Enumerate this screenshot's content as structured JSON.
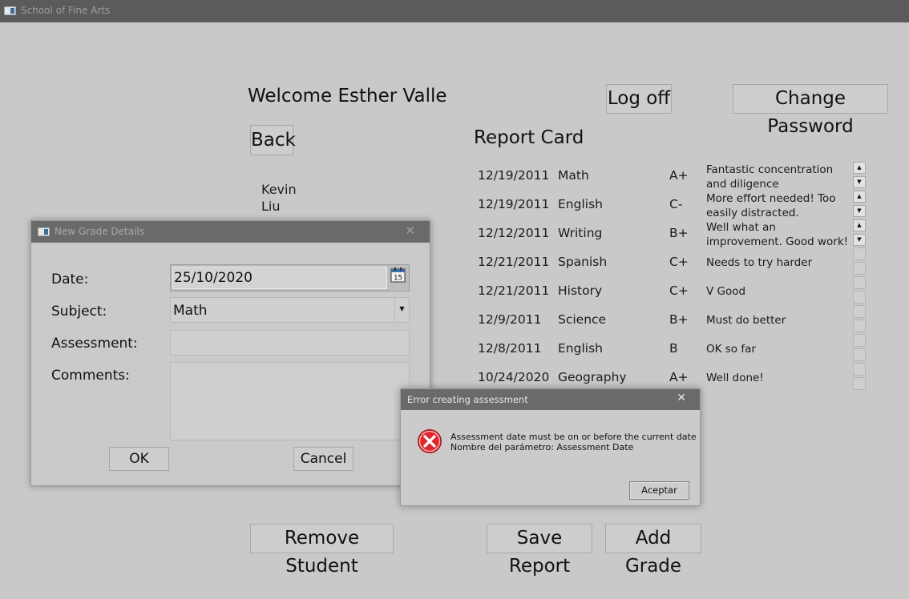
{
  "window": {
    "title": "School of Fine Arts"
  },
  "header": {
    "welcome": "Welcome Esther Valle",
    "logoff_label": "Log off",
    "change_password_label": "Change Password"
  },
  "nav": {
    "back_label": "Back"
  },
  "student": {
    "first_name": "Kevin",
    "last_name": "Liu"
  },
  "report": {
    "title": "Report Card",
    "rows": [
      {
        "date": "12/19/2011",
        "subject": "Math",
        "grade": "A+",
        "comment": "Fantastic concentration and diligence"
      },
      {
        "date": "12/19/2011",
        "subject": "English",
        "grade": "C-",
        "comment": "More effort needed! Too easily distracted."
      },
      {
        "date": "12/12/2011",
        "subject": "Writing",
        "grade": "B+",
        "comment": "Well what an improvement. Good work!"
      },
      {
        "date": "12/21/2011",
        "subject": "Spanish",
        "grade": "C+",
        "comment": "Needs to try harder"
      },
      {
        "date": "12/21/2011",
        "subject": "History",
        "grade": "C+",
        "comment": "V Good"
      },
      {
        "date": "12/9/2011",
        "subject": "Science",
        "grade": "B+",
        "comment": "Must do better"
      },
      {
        "date": "12/8/2011",
        "subject": "English",
        "grade": "B",
        "comment": "OK so far"
      },
      {
        "date": "10/24/2020",
        "subject": "Geography",
        "grade": "A+",
        "comment": "Well done!"
      }
    ]
  },
  "footer": {
    "remove_student_label": "Remove Student",
    "save_report_label": "Save Report",
    "add_grade_label": "Add Grade"
  },
  "grade_dialog": {
    "title": "New Grade Details",
    "date_label": "Date:",
    "date_value": "25/10/2020",
    "calendar_day": "15",
    "subject_label": "Subject:",
    "subject_value": "Math",
    "assessment_label": "Assessment:",
    "assessment_value": "",
    "comments_label": "Comments:",
    "comments_value": "",
    "ok_label": "OK",
    "cancel_label": "Cancel"
  },
  "error_dialog": {
    "title": "Error creating assessment",
    "line1": "Assessment date must be on or before the current date",
    "line2": "Nombre del parámetro: Assessment Date",
    "accept_label": "Aceptar"
  },
  "colors": {
    "background": "#c9c9c9",
    "titlebar": "#5b5b5b",
    "error_icon": "#d8232a"
  }
}
